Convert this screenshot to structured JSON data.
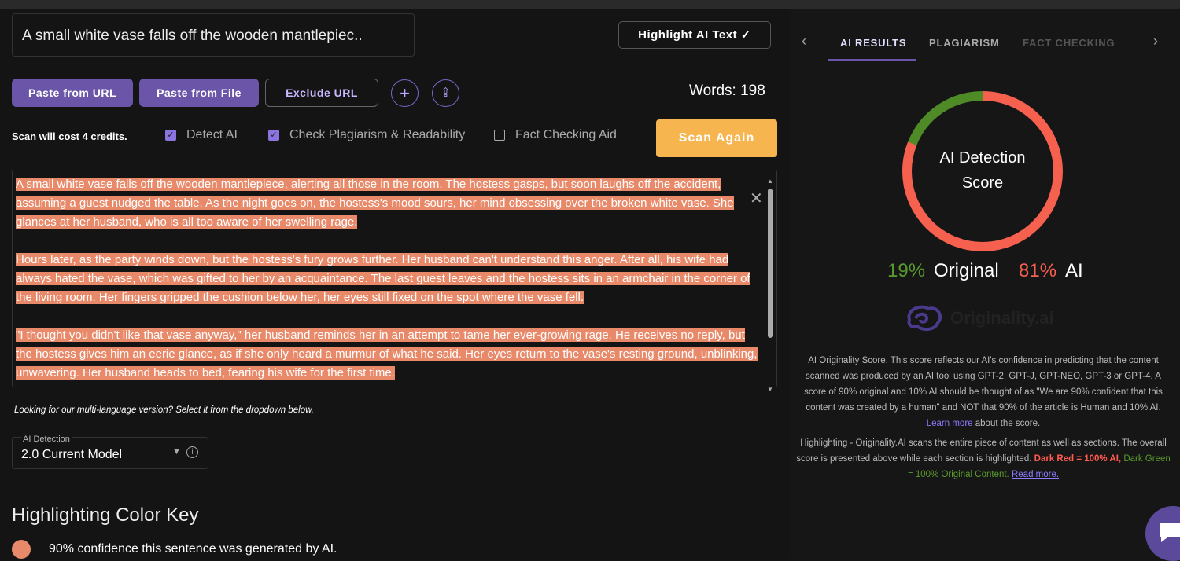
{
  "editor": {
    "title": "A small white vase falls off the wooden mantlepiec..",
    "highlight_button": "Highlight AI Text ✓",
    "buttons": {
      "paste_url": "Paste from URL",
      "paste_file": "Paste from File",
      "exclude_url": "Exclude URL",
      "add": "+",
      "share": "⇪"
    },
    "words": "Words: 198",
    "cost": "Scan will cost 4 credits.",
    "options": [
      {
        "label": "Detect AI",
        "checked": true
      },
      {
        "label": "Check Plagiarism & Readability",
        "checked": true
      },
      {
        "label": "Fact Checking Aid",
        "checked": false
      }
    ],
    "scan_button": "Scan Again",
    "paragraphs": [
      "A small white vase falls off the wooden mantlepiece, alerting all those in the room. The hostess gasps, but soon laughs off the accident, assuming a guest nudged the table. As the night goes on, the hostess's mood sours, her mind obsessing over the broken white vase. She glances at her husband, who is all too aware of her swelling rage.",
      "Hours later, as the party winds down, but the hostess's fury grows further. Her husband can't understand this anger. After all, his wife had always hated the vase, which was gifted to her by an acquaintance. The last guest leaves and the hostess sits in an armchair in the corner of the living room. Her fingers gripped the cushion below her, her eyes still fixed on the spot where the vase fell.",
      "\"I thought you didn't like that vase anyway,\" her husband reminds her in an attempt to tame her ever-growing rage. He receives no reply, but the hostess gives him an eerie glance, as if she only heard a murmur of what he said. Her eyes return to the vase's resting ground, unblinking, unwavering. Her husband heads to bed, fearing his wife for the first time."
    ],
    "highlight_color": "#e8896a",
    "multilang": "Looking for our multi-language version? Select it from the dropdown below.",
    "model_select": {
      "label": "AI Detection",
      "value": "2.0 Current Model"
    },
    "color_key": {
      "heading": "Highlighting Color Key",
      "items": [
        {
          "text": "90% confidence this sentence was generated by AI.",
          "color": "#e8896a"
        }
      ]
    }
  },
  "results": {
    "tabs": [
      "AI RESULTS",
      "PLAGIARISM",
      "FACT CHECKING"
    ],
    "active_tab": 0,
    "score_label_1": "AI Detection",
    "score_label_2": "Score",
    "original_pct": 19,
    "ai_pct": 81,
    "original_text": "19%",
    "original_label": "Original",
    "ai_text": "81%",
    "ai_label": "AI",
    "colors": {
      "original": "#4e8a26",
      "ai": "#f5604f",
      "accent": "#6a55a8"
    },
    "logo_text": "Originality.ai",
    "desc1": "AI Originality Score. This score reflects our AI's confidence in predicting that the content scanned was produced by an AI tool using GPT-2, GPT-J, GPT-NEO, GPT-3 or GPT-4. A score of 90% original and 10% AI should be thought of as \"We are 90% confident that this content was created by a human\" and NOT that 90% of the article is Human and 10% AI.",
    "learn_more": "Learn more",
    "desc1_end": " about the score.",
    "desc2": "Highlighting - Originality.AI scans the entire piece of content as well as sections. The overall score is presented above while each section is highlighted.",
    "dark_red": "Dark Red = 100% AI,",
    "dark_green": "Dark Green = 100% Original Content.",
    "read_more": "Read more."
  }
}
